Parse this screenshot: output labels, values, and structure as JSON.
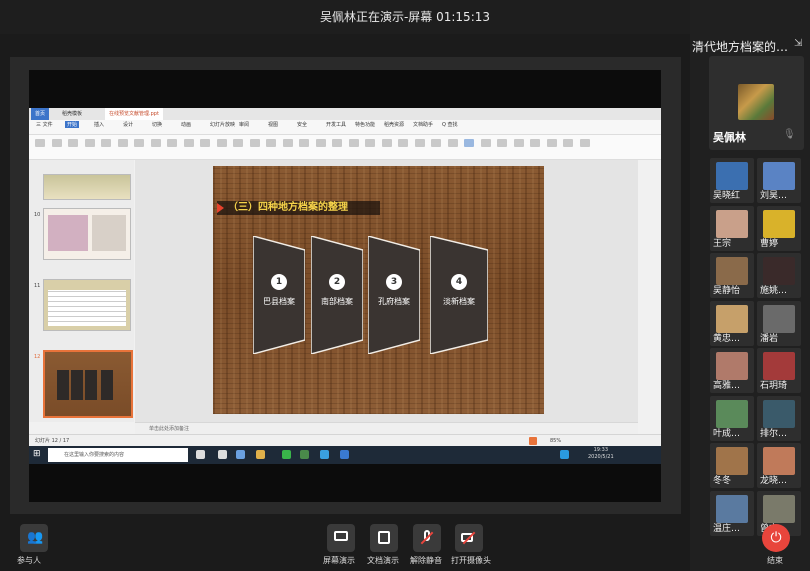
{
  "window": {
    "share_title": "吴佩林正在演示-屏幕 01:15:13"
  },
  "right_panel": {
    "meeting_title": "清代地方档案的…",
    "host": {
      "name": "吴佩林"
    },
    "participants": [
      {
        "name": "吴晓红",
        "color": "#3b6fb0"
      },
      {
        "name": "刘昊…",
        "color": "#5a83c4"
      },
      {
        "name": "王宗",
        "color": "#c9a08a"
      },
      {
        "name": "曹婷",
        "color": "#d9b22a"
      },
      {
        "name": "吴静怡",
        "color": "#8a6a4a"
      },
      {
        "name": "施姚…",
        "color": "#3a2a2a"
      },
      {
        "name": "黄忠…",
        "color": "#c6a06a"
      },
      {
        "name": "潘岩",
        "color": "#6a6a6a"
      },
      {
        "name": "高雅…",
        "color": "#b07a6a"
      },
      {
        "name": "石玥琦",
        "color": "#a33a3a"
      },
      {
        "name": "叶成…",
        "color": "#5a8a5a"
      },
      {
        "name": "排尔…",
        "color": "#3a5a6a"
      },
      {
        "name": "冬冬",
        "color": "#a0744a"
      },
      {
        "name": "龙晓…",
        "color": "#c07a5a"
      },
      {
        "name": "温庄…",
        "color": "#5a7aa0"
      },
      {
        "name": "曾文…",
        "color": "#7a7a6a"
      }
    ]
  },
  "ppt": {
    "tabs": [
      "首页",
      "稻壳模板",
      "在线预览文献管理.ppt"
    ],
    "menus": [
      "三 文件",
      "开始",
      "插入",
      "设计",
      "切换",
      "动画",
      "幻灯片放映",
      "审阅",
      "视图",
      "安全",
      "开发工具",
      "特色功能",
      "稻壳资源",
      "文档助手",
      "Q 查找"
    ],
    "thumb_numbers": [
      "10",
      "11",
      "12"
    ],
    "notes_placeholder": "单击此处添加备注",
    "status_left": "幻灯片 12 / 17",
    "status_zoom": "85%",
    "slide": {
      "title": "（三）四种地方档案的整理",
      "cards": [
        {
          "num": "1",
          "label": "巴县档案"
        },
        {
          "num": "2",
          "label": "南部档案"
        },
        {
          "num": "3",
          "label": "孔府档案"
        },
        {
          "num": "4",
          "label": "淡新档案"
        }
      ]
    },
    "taskbar": {
      "search_placeholder": "在这里输入你要搜索的内容",
      "time": "19:33",
      "date": "2020/5/21"
    }
  },
  "bottom_toolbar": {
    "participants_label": "参与人",
    "screen_share_label": "屏幕演示",
    "doc_share_label": "文档演示",
    "unmute_label": "解除静音",
    "camera_label": "打开摄像头",
    "end_label": "结束"
  }
}
